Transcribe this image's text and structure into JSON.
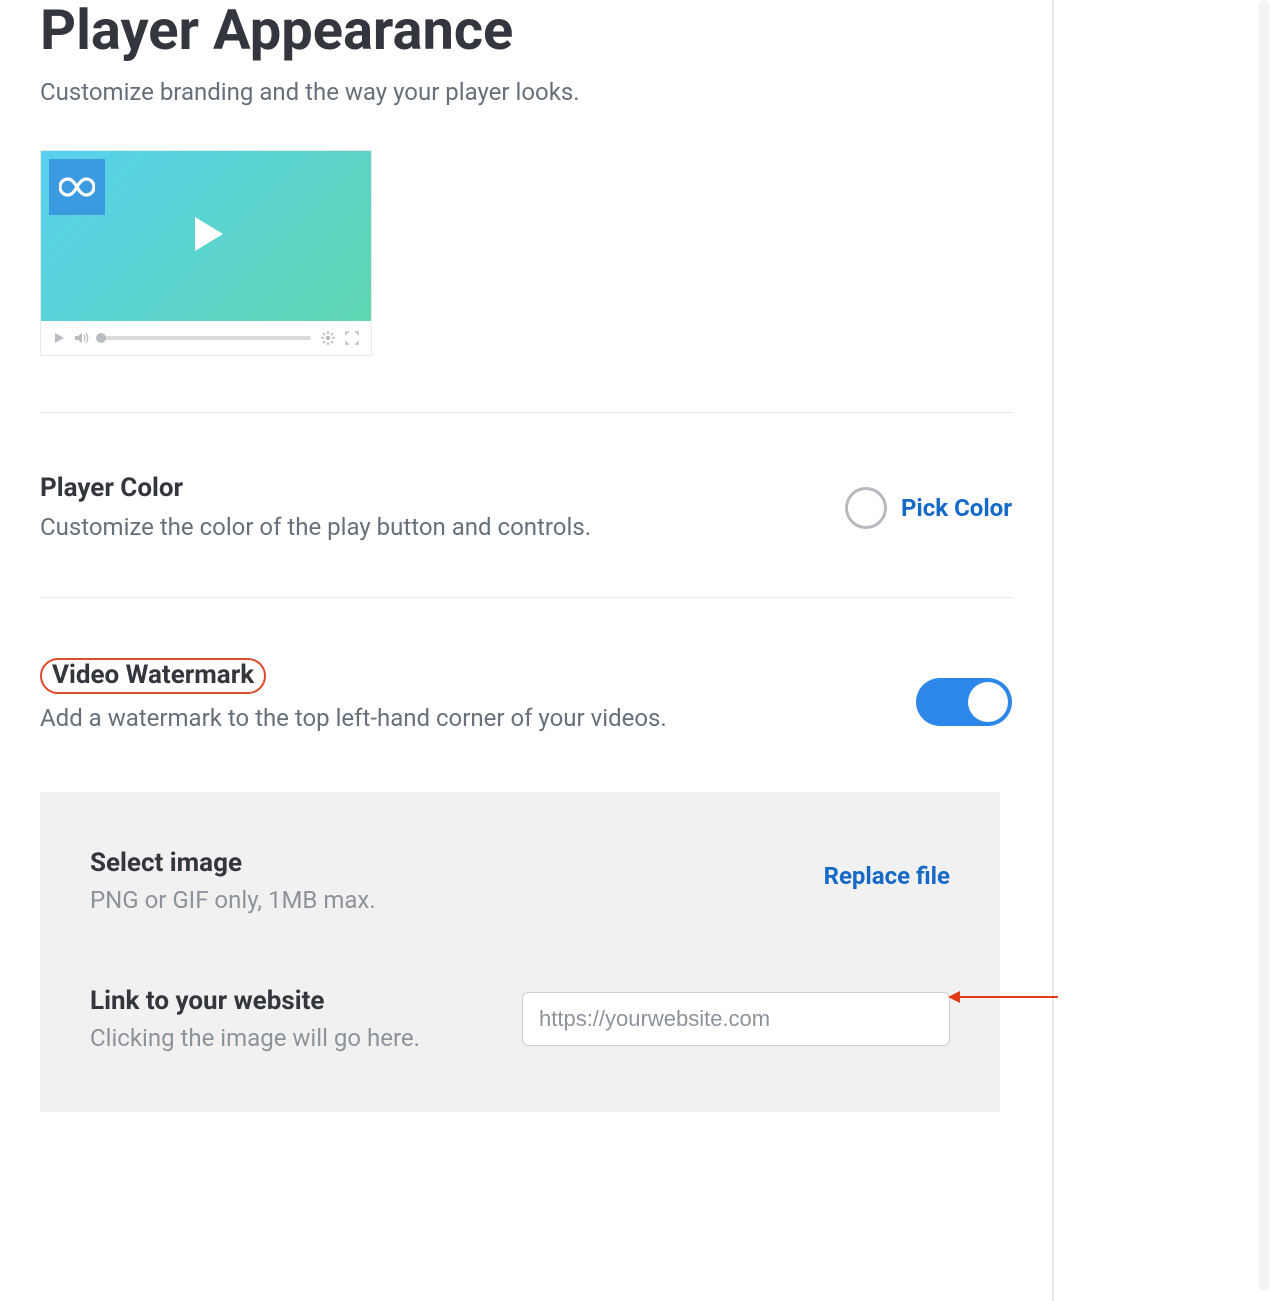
{
  "header": {
    "title": "Player Appearance",
    "subtitle": "Customize branding and the way your player looks."
  },
  "playerColor": {
    "heading": "Player Color",
    "description": "Customize the color of the play button and controls.",
    "pick_label": "Pick Color"
  },
  "watermark": {
    "heading": "Video Watermark",
    "description": "Add a watermark to the top left-hand corner of your videos.",
    "enabled": true
  },
  "selectImage": {
    "heading": "Select image",
    "description": "PNG or GIF only, 1MB max.",
    "replace_label": "Replace file"
  },
  "linkWebsite": {
    "heading": "Link to your website",
    "description": "Clicking the image will go here.",
    "placeholder": "https://yourwebsite.com",
    "value": ""
  }
}
